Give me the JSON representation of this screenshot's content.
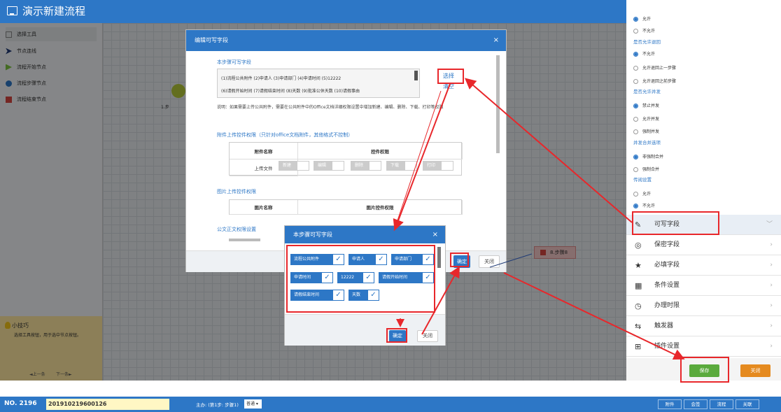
{
  "app": {
    "title": "演示新建流程"
  },
  "tools": [
    {
      "label": "选择工具",
      "icon": "cursor-icon",
      "color": "#888888"
    },
    {
      "label": "节点连线",
      "icon": "connector-arrow-icon",
      "color": "#1f3a75"
    },
    {
      "label": "流程开始节点",
      "icon": "play-icon",
      "color": "#7cc340"
    },
    {
      "label": "流程步骤节点",
      "icon": "circle-node-icon",
      "color": "#2d77c6"
    },
    {
      "label": "流程结束节点",
      "icon": "stop-square-icon",
      "color": "#d64541"
    }
  ],
  "tips": {
    "title": "小技巧",
    "text": "选择工具按钮，用于选中节点按钮。",
    "prev": "◄上一条",
    "next": "下一条►"
  },
  "canvas": {
    "step1_label": "1.步",
    "step8_label": "8.步骤8"
  },
  "edit_dialog": {
    "title": "编辑可写字段",
    "close": "×",
    "section_fields": "本步骤可写字段",
    "fields_line1": "(1)流程公共附件  (2)申请人  (3)申请部门  (4)申请时间  (5)12222",
    "fields_line2": "(6)请假开始时间  (7)请假结束时间  (8)天数  (9)批准公休天数  (10)请假事由",
    "select_link": "选择",
    "clear_link": "清空",
    "note": "说明：如果需要上传公共附件，需要在公共附件中的Office文档详细权限设置中增加新建、编辑、删除、下载、打印等权限",
    "attach_section": "附件上传控件权限（只针对office文档附件，其他格式不控制）",
    "attach_col1": "附件名称",
    "attach_col2": "控件权限",
    "attach_row": "上传文件",
    "permissions": [
      "新建",
      "编辑",
      "删除",
      "下载",
      "打印"
    ],
    "image_section": "图片上传控件权限",
    "image_col1": "图片名称",
    "image_col2": "图片控件权限",
    "doc_section": "公文正文权限设置",
    "ok": "确定",
    "close_btn": "关闭"
  },
  "pick_dialog": {
    "title": "本步骤可写字段",
    "close": "×",
    "chips": [
      "流程公共附件",
      "申请人",
      "申请部门",
      "申请时间",
      "12222",
      "请假开始时间",
      "请假结束时间",
      "天数"
    ],
    "check": "✓",
    "ok": "确定",
    "close_btn": "关闭"
  },
  "right_panel": {
    "top_opts": [
      {
        "label": "允许",
        "on": true
      },
      {
        "label": "不允许",
        "on": false
      }
    ],
    "return_head": "是否允许退回",
    "return_opts": [
      {
        "label": "不允许",
        "on": true
      },
      {
        "label": "允许退回上一步骤",
        "on": false
      },
      {
        "label": "允许退回之前步骤",
        "on": false
      }
    ],
    "concurrent_head": "是否允许并发",
    "concurrent_opts": [
      {
        "label": "禁止并发",
        "on": true
      },
      {
        "label": "允许并发",
        "on": false
      },
      {
        "label": "强制并发",
        "on": false
      }
    ],
    "merge_head": "并发合并选项",
    "merge_opts": [
      {
        "label": "非强制合并",
        "on": true
      },
      {
        "label": "强制合并",
        "on": false
      }
    ],
    "cc_head": "传阅设置",
    "cc_opts": [
      {
        "label": "允许",
        "on": false
      },
      {
        "label": "不允许",
        "on": true
      }
    ],
    "accordion": [
      {
        "label": "可写字段",
        "icon": "pencil-icon",
        "chev": "﹀"
      },
      {
        "label": "保密字段",
        "icon": "eye-slash-icon",
        "chev": "›"
      },
      {
        "label": "必填字段",
        "icon": "star-icon",
        "chev": "›"
      },
      {
        "label": "条件设置",
        "icon": "grid-icon",
        "chev": "›"
      },
      {
        "label": "办理时限",
        "icon": "clock-icon",
        "chev": "›"
      },
      {
        "label": "触发器",
        "icon": "shuffle-icon",
        "chev": "›"
      },
      {
        "label": "插件设置",
        "icon": "plugin-icon",
        "chev": "›"
      }
    ],
    "save": "保存",
    "close": "关闭"
  },
  "footer": {
    "no_label": "NO. 2196",
    "no_value": "201910219600126",
    "host": "主办: (第1步: 步骤1)",
    "level": "普通",
    "buttons": [
      "附件",
      "会签",
      "流程",
      "关联"
    ]
  }
}
